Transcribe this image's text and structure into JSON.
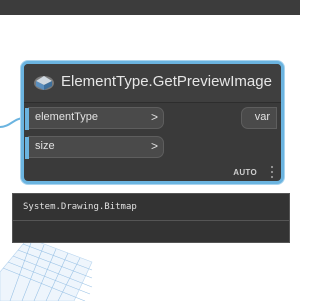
{
  "node": {
    "title": "ElementType.GetPreviewImage",
    "inputs": [
      {
        "label": "elementType",
        "chevron": ">"
      },
      {
        "label": "size",
        "chevron": ">"
      }
    ],
    "output": {
      "label": "var"
    },
    "lacing": "AUTO"
  },
  "preview": {
    "value": "System.Drawing.Bitmap"
  },
  "colors": {
    "accent": "#6bb4e0",
    "node_body": "#3a3a3a",
    "top_bar": "#3c3c3c",
    "preview_bg": "#333333"
  },
  "icons": {
    "node_icon": "cube-icon",
    "menu": "vertical-dots-icon"
  }
}
